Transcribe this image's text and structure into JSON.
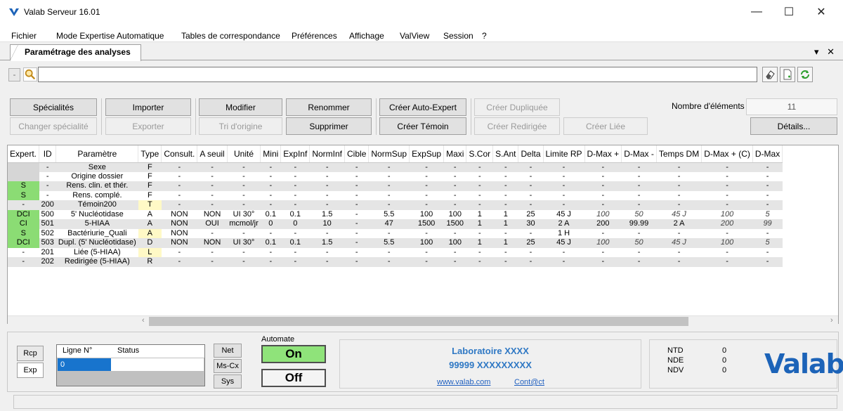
{
  "window": {
    "title": "Valab Serveur 16.01",
    "min": "—",
    "max": "☐",
    "close": "✕"
  },
  "menu": [
    "Fichier",
    "Mode Expertise Automatique",
    "Tables de correspondance",
    "Préférences",
    "Affichage",
    "ValView",
    "Session",
    "?"
  ],
  "tab": {
    "label": "Paramétrage des analyses",
    "controls": "▾ ✕"
  },
  "toolbar": {
    "minus": "-",
    "search_value": ""
  },
  "buttons": {
    "specialites": "Spécialités",
    "changer_specialite": "Changer spécialité",
    "importer": "Importer",
    "exporter": "Exporter",
    "modifier": "Modifier",
    "tri_origine": "Tri d'origine",
    "renommer": "Renommer",
    "supprimer": "Supprimer",
    "creer_auto_expert": "Créer Auto-Expert",
    "creer_temoin": "Créer Témoin",
    "creer_dupliquee": "Créer Dupliquée",
    "creer_redirigee": "Créer Redirigée",
    "creer_liee": "Créer Liée",
    "details": "Détails..."
  },
  "count": {
    "label": "Nombre d'éléments :",
    "value": "11"
  },
  "grid": {
    "columns": [
      "Expert.",
      "ID",
      "Paramètre",
      "Type",
      "Consult.",
      "A seuil",
      "Unité",
      "Mini",
      "ExpInf",
      "NormInf",
      "Cible",
      "NormSup",
      "ExpSup",
      "Maxi",
      "S.Cor",
      "S.Ant",
      "Delta",
      "Limite RP",
      "D-Max +",
      "D-Max -",
      "Temps DM",
      "D-Max + (C)",
      "D-Max"
    ],
    "rows": [
      {
        "expert": "",
        "expert_color": "gray",
        "type_color": "",
        "italic_from": 99,
        "cells": [
          "",
          "-",
          "Sexe",
          "F",
          "-",
          "-",
          "-",
          "-",
          "-",
          "-",
          "-",
          "-",
          "-",
          "-",
          "-",
          "-",
          "-",
          "-",
          "-",
          "-",
          "-",
          "-",
          "-"
        ]
      },
      {
        "expert": "",
        "expert_color": "gray",
        "type_color": "",
        "italic_from": 99,
        "cells": [
          "",
          "-",
          "Origine dossier",
          "F",
          "-",
          "-",
          "-",
          "-",
          "-",
          "-",
          "-",
          "-",
          "-",
          "-",
          "-",
          "-",
          "-",
          "-",
          "-",
          "-",
          "-",
          "-",
          "-"
        ]
      },
      {
        "expert": "S",
        "expert_color": "green",
        "type_color": "",
        "italic_from": 99,
        "cells": [
          "S",
          "-",
          "Rens. clin. et thér.",
          "F",
          "-",
          "-",
          "-",
          "-",
          "-",
          "-",
          "-",
          "-",
          "-",
          "-",
          "-",
          "-",
          "-",
          "-",
          "-",
          "-",
          "-",
          "-",
          "-"
        ]
      },
      {
        "expert": "S",
        "expert_color": "green",
        "type_color": "",
        "italic_from": 99,
        "cells": [
          "S",
          "-",
          "Rens. complé.",
          "F",
          "-",
          "-",
          "-",
          "-",
          "-",
          "-",
          "-",
          "-",
          "-",
          "-",
          "-",
          "-",
          "-",
          "-",
          "-",
          "-",
          "-",
          "-",
          "-"
        ]
      },
      {
        "expert": "-",
        "expert_color": "",
        "type_color": "yellow",
        "italic_from": 99,
        "cells": [
          "-",
          "200",
          "Témoin200",
          "T",
          "-",
          "-",
          "-",
          "-",
          "-",
          "-",
          "-",
          "-",
          "-",
          "-",
          "-",
          "-",
          "-",
          "-",
          "-",
          "-",
          "-",
          "-",
          "-"
        ]
      },
      {
        "expert": "DCI",
        "expert_color": "green",
        "type_color": "",
        "italic_from": 18,
        "cells": [
          "DCI",
          "500",
          "5' Nucléotidase",
          "A",
          "NON",
          "NON",
          "UI 30°",
          "0.1",
          "0.1",
          "1.5",
          "-",
          "5.5",
          "100",
          "100",
          "1",
          "1",
          "25",
          "45 J",
          "100",
          "50",
          "45 J",
          "100",
          "5"
        ]
      },
      {
        "expert": "CI",
        "expert_color": "green",
        "type_color": "",
        "italic_from": 21,
        "cells": [
          "CI",
          "501",
          "5-HIAA",
          "A",
          "NON",
          "OUI",
          "mcmol/jr",
          "0",
          "0",
          "10",
          "-",
          "47",
          "1500",
          "1500",
          "1",
          "1",
          "30",
          "2 A",
          "200",
          "99.99",
          "2 A",
          "200",
          "99"
        ]
      },
      {
        "expert": "S",
        "expert_color": "green",
        "type_color": "yellow",
        "italic_from": 99,
        "cells": [
          "S",
          "502",
          "Bactériurie_Quali",
          "A",
          "NON",
          "-",
          "-",
          "-",
          "-",
          "-",
          "-",
          "-",
          "-",
          "-",
          "-",
          "-",
          "-",
          "1 H",
          "-",
          "-",
          "-",
          "-",
          "-"
        ]
      },
      {
        "expert": "DCI",
        "expert_color": "green",
        "type_color": "",
        "italic_from": 18,
        "cells": [
          "DCI",
          "503",
          "Dupl. (5' Nucléotidase)",
          "D",
          "NON",
          "NON",
          "UI 30°",
          "0.1",
          "0.1",
          "1.5",
          "-",
          "5.5",
          "100",
          "100",
          "1",
          "1",
          "25",
          "45 J",
          "100",
          "50",
          "45 J",
          "100",
          "5"
        ]
      },
      {
        "expert": "-",
        "expert_color": "",
        "type_color": "yellow",
        "italic_from": 99,
        "cells": [
          "-",
          "201",
          "Liée (5-HIAA)",
          "L",
          "-",
          "-",
          "-",
          "-",
          "-",
          "-",
          "-",
          "-",
          "-",
          "-",
          "-",
          "-",
          "-",
          "-",
          "-",
          "-",
          "-",
          "-",
          "-"
        ]
      },
      {
        "expert": "-",
        "expert_color": "",
        "type_color": "",
        "italic_from": 99,
        "cells": [
          "-",
          "202",
          "Redirigée (5-HIAA)",
          "R",
          "-",
          "-",
          "-",
          "-",
          "-",
          "-",
          "-",
          "-",
          "-",
          "-",
          "-",
          "-",
          "-",
          "-",
          "-",
          "-",
          "-",
          "-",
          "-"
        ]
      }
    ]
  },
  "bottom": {
    "rcp": "Rcp",
    "exp": "Exp",
    "ligne_header": "Ligne N°",
    "status_header": "Status",
    "ligne_value": "0",
    "net": "Net",
    "mscx": "Ms-Cx",
    "sys": "Sys",
    "automate_label": "Automate",
    "on": "On",
    "off": "Off",
    "lab_name": "Laboratoire XXXX",
    "lab_code": "99999 XXXXXXXXX",
    "lab_web": "www.valab.com",
    "lab_mail": "Cont@ct",
    "ntd_label": "NTD",
    "ntd_value": "0",
    "nde_label": "NDE",
    "nde_value": "0",
    "ndv_label": "NDV",
    "ndv_value": "0",
    "logo": "Valab"
  },
  "colors": {
    "accent": "#1c63b8",
    "green": "#8bdc74",
    "gray": "#d6d6d6",
    "yellow": "#fff9c6",
    "selected": "#1874cd"
  }
}
